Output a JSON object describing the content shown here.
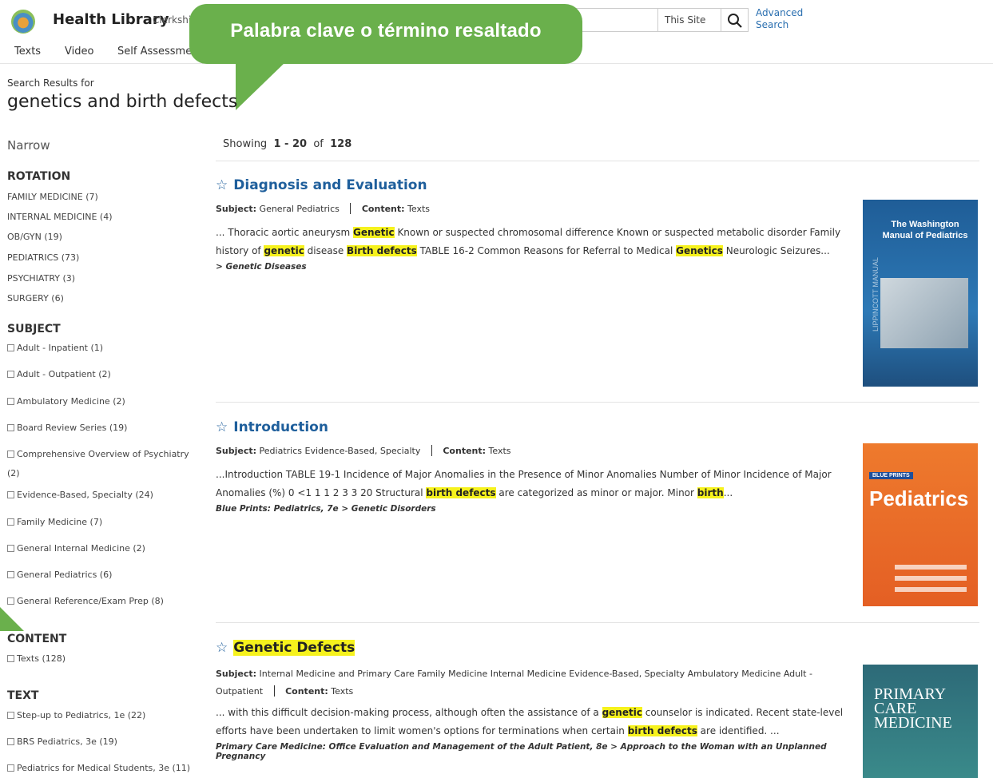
{
  "header": {
    "brand": "Health Library",
    "brand_sub": "Clerkshi",
    "site_scope": "This Site",
    "advanced_search": "Advanced Search"
  },
  "nav": [
    "Texts",
    "Video",
    "Self Assessment"
  ],
  "callout": {
    "text": "Palabra clave o término resaltado",
    "color": "#6ab04c"
  },
  "search": {
    "results_for": "Search Results for",
    "query": "genetics and birth defects"
  },
  "sidebar": {
    "narrow": "Narrow",
    "rotation": {
      "heading": "ROTATION",
      "items": [
        "FAMILY MEDICINE (7)",
        "INTERNAL MEDICINE (4)",
        "OB/GYN (19)",
        "PEDIATRICS (73)",
        "PSYCHIATRY (3)",
        "SURGERY (6)"
      ]
    },
    "subject": {
      "heading": "SUBJECT",
      "items": [
        "Adult - Inpatient (1)",
        "Adult - Outpatient (2)",
        "Ambulatory Medicine (2)",
        "Board Review Series (19)",
        "Comprehensive Overview of Psychiatry (2)",
        "Evidence-Based, Specialty (24)",
        "Family Medicine (7)",
        "General Internal Medicine (2)",
        "General Pediatrics (6)",
        "General Reference/Exam Prep (8)"
      ]
    },
    "content": {
      "heading": "CONTENT",
      "items": [
        "Texts (128)"
      ]
    },
    "text": {
      "heading": "TEXT",
      "items": [
        "Step-up to Pediatrics, 1e (22)",
        "BRS Pediatrics, 3e (19)",
        "Pediatrics for Medical Students, 3e (11)"
      ]
    }
  },
  "results_info": {
    "prefix": "Showing",
    "range": "1 - 20",
    "of": "of",
    "total": "128"
  },
  "results": [
    {
      "title": "Diagnosis and Evaluation",
      "subject_label": "Subject:",
      "subject": "General Pediatrics",
      "content_label": "Content:",
      "content": "Texts",
      "snippet": [
        {
          "t": "... Thoracic aortic aneurysm "
        },
        {
          "t": "Genetic",
          "hl": true
        },
        {
          "t": " Known or suspected chromosomal difference Known or suspected metabolic disorder Family history of "
        },
        {
          "t": "genetic",
          "hl": true
        },
        {
          "t": " disease "
        },
        {
          "t": "Birth defects",
          "hl": true
        },
        {
          "t": " TABLE 16-2 Common Reasons for Referral to Medical "
        },
        {
          "t": "Genetics",
          "hl": true
        },
        {
          "t": " Neurologic Seizures..."
        }
      ],
      "path": "> Genetic Diseases",
      "cover": {
        "title": "The Washington Manual of Pediatrics",
        "spine": "LIPPINCOTT MANUAL"
      }
    },
    {
      "title": "Introduction",
      "subject_label": "Subject:",
      "subject": "Pediatrics Evidence-Based, Specialty",
      "content_label": "Content:",
      "content": "Texts",
      "snippet": [
        {
          "t": "...Introduction TABLE 19-1 Incidence of Major Anomalies in the Presence of Minor Anomalies Number of Minor Incidence of Major Anomalies (%) 0 <1 1 1 2 3 3 20 Structural "
        },
        {
          "t": "birth defects",
          "hl": true
        },
        {
          "t": " are categorized as minor or major. Minor "
        },
        {
          "t": "birth",
          "hl": true
        },
        {
          "t": "..."
        }
      ],
      "path": "Blue Prints: Pediatrics, 7e > Genetic Disorders",
      "cover": {
        "title": "Pediatrics",
        "badge": "BLUE PRINTS"
      }
    },
    {
      "title": "Genetic Defects",
      "title_highlight": true,
      "subject_label": "Subject:",
      "subject": "Internal Medicine and Primary Care Family Medicine Internal Medicine Evidence-Based, Specialty Ambulatory Medicine Adult - Outpatient",
      "content_label": "Content:",
      "content": "Texts",
      "snippet": [
        {
          "t": "... with this difficult decision-making process, although often the assistance of a "
        },
        {
          "t": "genetic",
          "hl": true
        },
        {
          "t": " counselor is indicated. Recent state-level efforts have been undertaken to limit women's options for terminations when certain "
        },
        {
          "t": "birth defects",
          "hl": true
        },
        {
          "t": " are identified. ..."
        }
      ],
      "path": "Primary Care Medicine: Office Evaluation and Management of the Adult Patient, 8e > Approach to the Woman with an Unplanned Pregnancy",
      "cover": {
        "title": "PRIMARY CARE MEDICINE"
      }
    }
  ]
}
